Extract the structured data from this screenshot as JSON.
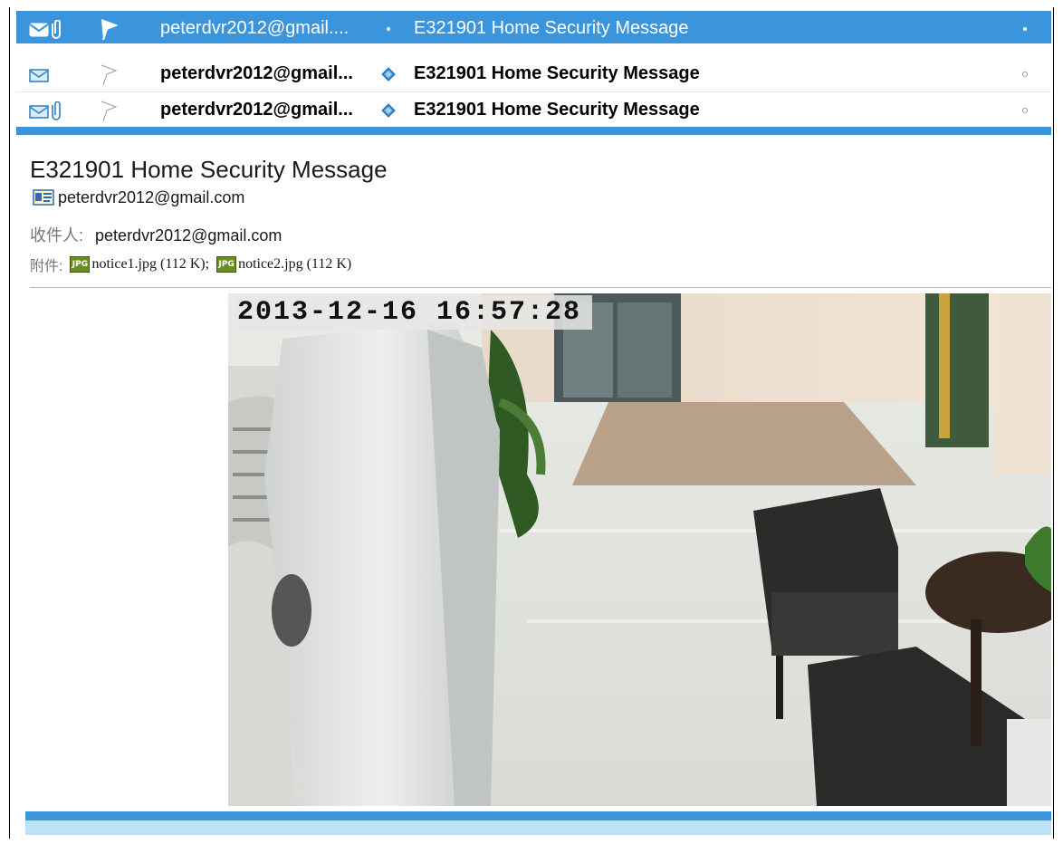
{
  "message_list": [
    {
      "selected": true,
      "icons": [
        "envelope-icon",
        "attachment-icon"
      ],
      "flag": "flag-icon",
      "from": "peterdvr2012@gmail....",
      "subject": "E321901 Home Security Message",
      "unread": false
    },
    {
      "selected": false,
      "icons": [
        "envelope-icon"
      ],
      "flag": "flag-icon",
      "from": "peterdvr2012@gmail...",
      "subject": "E321901 Home Security Message",
      "unread": true
    },
    {
      "selected": false,
      "icons": [
        "envelope-icon",
        "attachment-icon"
      ],
      "flag": "flag-icon",
      "from": "peterdvr2012@gmail...",
      "subject": "E321901 Home Security Message",
      "unread": true
    }
  ],
  "message": {
    "subject": "E321901 Home Security Message",
    "from": "peterdvr2012@gmail.com",
    "to_label": "收件人:",
    "to": "peterdvr2012@gmail.com",
    "attachments_label": "附件:",
    "attachments": [
      {
        "text": "notice1.jpg (112 K);",
        "icon": "jpg-icon",
        "icon_text": "JPG"
      },
      {
        "text": "notice2.jpg (112 K)",
        "icon": "jpg-icon",
        "icon_text": "JPG"
      }
    ]
  },
  "snapshot": {
    "timestamp": "2013-12-16 16:57:28"
  },
  "colors": {
    "selection": "#3b95dc",
    "unread_dot": "#3b95dc",
    "bottom_light": "#bfe1f7"
  }
}
